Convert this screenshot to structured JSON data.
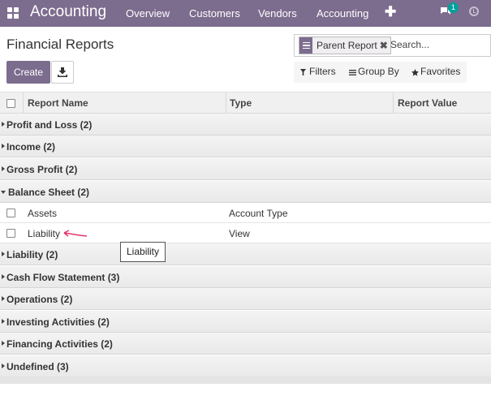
{
  "navbar": {
    "brand": "Accounting",
    "menu": [
      {
        "label": "Overview"
      },
      {
        "label": "Customers"
      },
      {
        "label": "Vendors"
      },
      {
        "label": "Accounting"
      }
    ],
    "plus": "✚",
    "chat_badge": "1",
    "icons": [
      "apps-grid-icon",
      "plus-icon",
      "chat-icon",
      "clock-icon"
    ]
  },
  "control_panel": {
    "title": "Financial Reports",
    "create_label": "Create",
    "download_icon": "download-icon",
    "search": {
      "facet_value": "Parent Report",
      "facet_close": "✖",
      "placeholder": "Search..."
    },
    "filters_label": "Filters",
    "group_by_label": "Group By",
    "favorites_label": "Favorites"
  },
  "list": {
    "columns": [
      "Report Name",
      "Type",
      "Report Value"
    ],
    "groups": [
      {
        "label": "Profit and Loss (2)",
        "open": false
      },
      {
        "label": "Income (2)",
        "open": false
      },
      {
        "label": "Gross Profit (2)",
        "open": false
      },
      {
        "label": "Balance Sheet (2)",
        "open": true,
        "rows": [
          {
            "name": "Assets",
            "type": "Account Type"
          },
          {
            "name": "Liability",
            "type": "View"
          }
        ]
      },
      {
        "label": "Liability (2)",
        "open": false
      },
      {
        "label": "Cash Flow Statement (3)",
        "open": false
      },
      {
        "label": "Operations (2)",
        "open": false
      },
      {
        "label": "Investing Activities (2)",
        "open": false
      },
      {
        "label": "Financing Activities (2)",
        "open": false
      },
      {
        "label": "Undefined (3)",
        "open": false
      }
    ],
    "tooltip": "Liability",
    "arrow_color": "#e8336b"
  },
  "colors": {
    "brand": "#7c6c8e",
    "badge": "#00a09d"
  }
}
